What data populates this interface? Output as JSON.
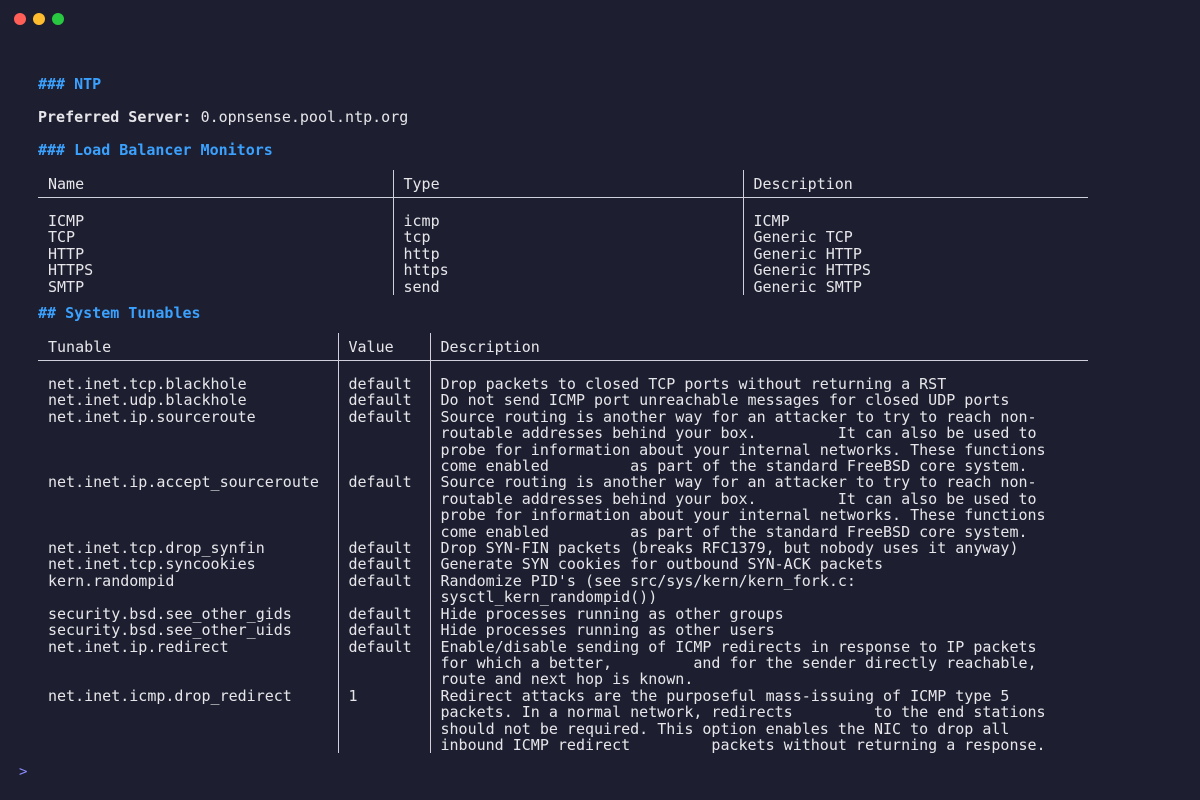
{
  "window": {
    "controls": [
      "close",
      "minimize",
      "zoom"
    ]
  },
  "ntp": {
    "heading": "### NTP",
    "preferred_label": "Preferred Server:",
    "preferred_value": "0.opnsense.pool.ntp.org"
  },
  "lb": {
    "heading": "### Load Balancer Monitors",
    "columns": [
      "Name",
      "Type",
      "Description"
    ],
    "rows": [
      [
        "ICMP",
        "icmp",
        "ICMP"
      ],
      [
        "TCP",
        "tcp",
        "Generic TCP"
      ],
      [
        "HTTP",
        "http",
        "Generic HTTP"
      ],
      [
        "HTTPS",
        "https",
        "Generic HTTPS"
      ],
      [
        "SMTP",
        "send",
        "Generic SMTP"
      ]
    ]
  },
  "tunables": {
    "heading": "## System Tunables",
    "columns": [
      "Tunable",
      "Value",
      "Description"
    ],
    "rows": [
      [
        "net.inet.tcp.blackhole",
        "default",
        "Drop packets to closed TCP ports without returning a RST"
      ],
      [
        "net.inet.udp.blackhole",
        "default",
        "Do not send ICMP port unreachable messages for closed UDP ports"
      ],
      [
        "net.inet.ip.sourceroute",
        "default",
        "Source routing is another way for an attacker to try to reach non-\nroutable addresses behind your box.         It can also be used to\nprobe for information about your internal networks. These functions\ncome enabled         as part of the standard FreeBSD core system."
      ],
      [
        "net.inet.ip.accept_sourceroute",
        "default",
        "Source routing is another way for an attacker to try to reach non-\nroutable addresses behind your box.         It can also be used to\nprobe for information about your internal networks. These functions\ncome enabled         as part of the standard FreeBSD core system."
      ],
      [
        "net.inet.tcp.drop_synfin",
        "default",
        "Drop SYN-FIN packets (breaks RFC1379, but nobody uses it anyway)"
      ],
      [
        "net.inet.tcp.syncookies",
        "default",
        "Generate SYN cookies for outbound SYN-ACK packets"
      ],
      [
        "kern.randompid",
        "default",
        "Randomize PID's (see src/sys/kern/kern_fork.c:\nsysctl_kern_randompid())"
      ],
      [
        "security.bsd.see_other_gids",
        "default",
        "Hide processes running as other groups"
      ],
      [
        "security.bsd.see_other_uids",
        "default",
        "Hide processes running as other users"
      ],
      [
        "net.inet.ip.redirect",
        "default",
        "Enable/disable sending of ICMP redirects in response to IP packets\nfor which a better,         and for the sender directly reachable,\nroute and next hop is known."
      ],
      [
        "net.inet.icmp.drop_redirect",
        "1",
        "Redirect attacks are the purposeful mass-issuing of ICMP type 5\npackets. In a normal network, redirects         to the end stations\nshould not be required. This option enables the NIC to drop all\ninbound ICMP redirect         packets without returning a response."
      ]
    ]
  },
  "prompt": {
    "symbol": ">"
  }
}
